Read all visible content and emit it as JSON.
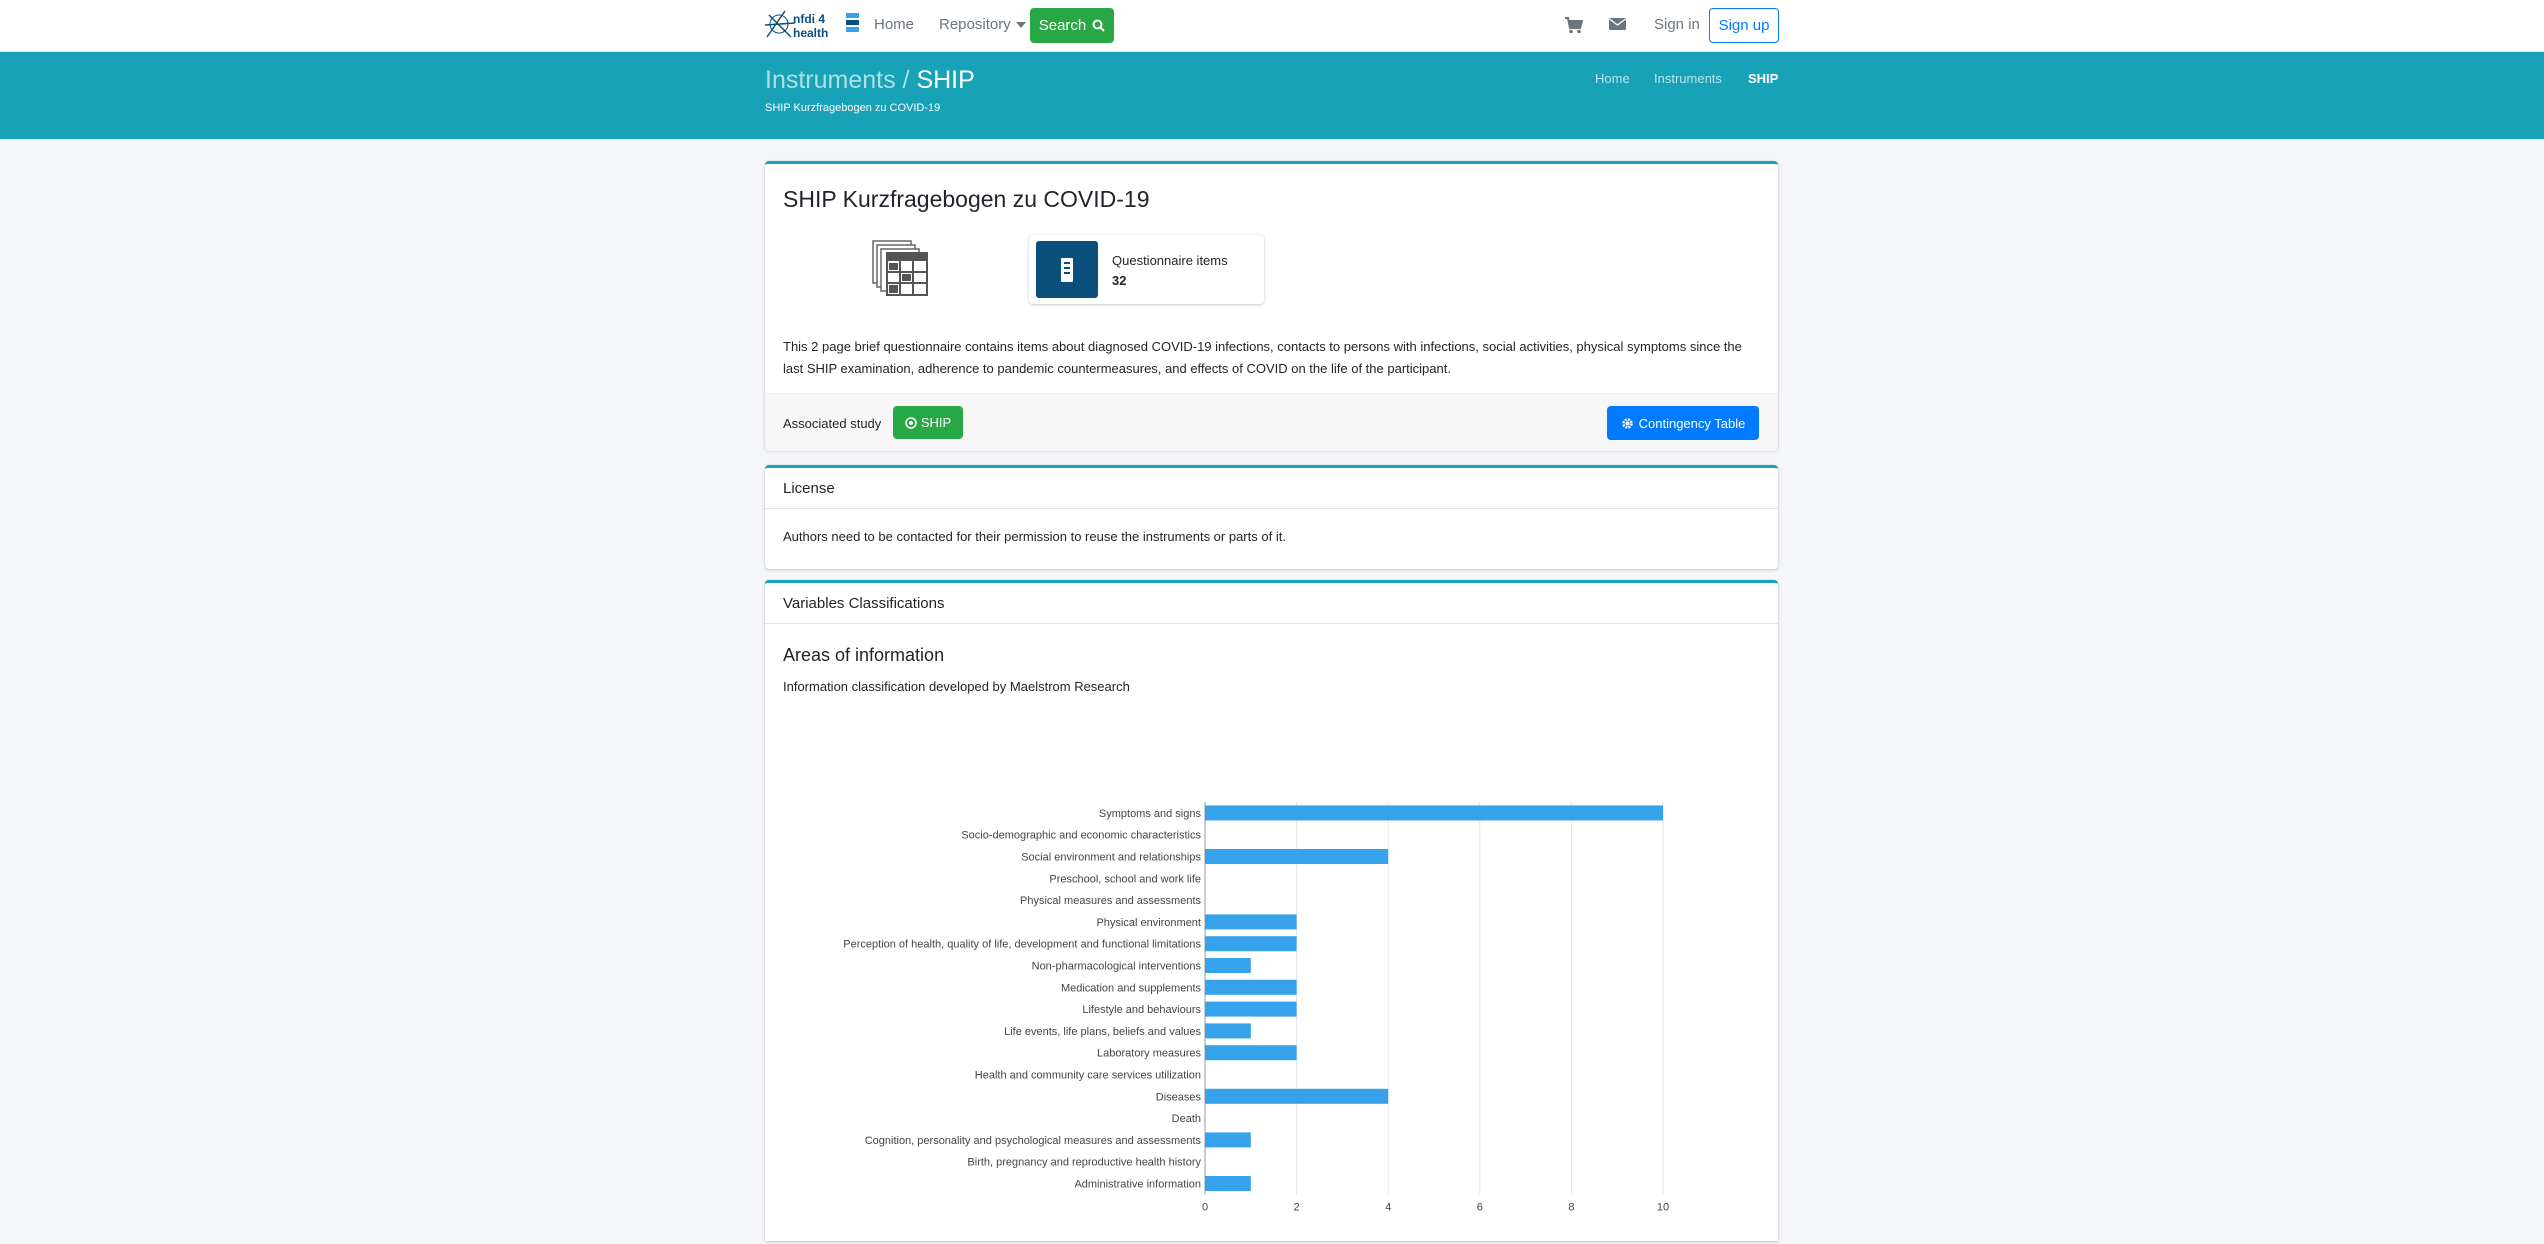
{
  "nav": {
    "logo_text": "nfdi 4 health",
    "home": "Home",
    "repository": "Repository",
    "search": "Search",
    "signin": "Sign in",
    "signup": "Sign up"
  },
  "header": {
    "title_muted": "Instruments /",
    "title_main": "SHIP",
    "subtitle": "SHIP Kurzfragebogen zu COVID-19",
    "breadcrumb": [
      "Home",
      "Instruments",
      "SHIP"
    ]
  },
  "study": {
    "title": "SHIP Kurzfragebogen zu COVID-19",
    "info_label": "Questionnaire items",
    "info_value": "32",
    "description": "This 2 page brief questionnaire contains items about diagnosed COVID-19 infections, contacts to persons with infections, social activities, physical symptoms since the last SHIP examination, adherence to pandemic countermeasures, and effects of COVID on the life of the participant.",
    "assoc_label": "Associated study",
    "assoc_button": "SHIP",
    "contingency_button": "Contingency Table"
  },
  "license": {
    "title": "License",
    "text": "Authors need to be contacted for their permission to reuse the instruments or parts of it."
  },
  "classifications": {
    "title": "Variables Classifications",
    "areas_title": "Areas of information",
    "areas_subtitle": "Information classification developed by Maelstrom Research"
  },
  "colors": {
    "accent": "#17a2b8",
    "bar": "#36a2eb",
    "success": "#28a745",
    "primary": "#007bff"
  },
  "chart_data": {
    "type": "bar",
    "orientation": "horizontal",
    "categories": [
      "Symptoms and signs",
      "Socio-demographic and economic characteristics",
      "Social environment and relationships",
      "Preschool, school and work life",
      "Physical measures and assessments",
      "Physical environment",
      "Perception of health, quality of life, development and functional limitations",
      "Non-pharmacological interventions",
      "Medication and supplements",
      "Lifestyle and behaviours",
      "Life events, life plans, beliefs and values",
      "Laboratory measures",
      "Health and community care services utilization",
      "Diseases",
      "Death",
      "Cognition, personality and psychological measures and assessments",
      "Birth, pregnancy and reproductive health history",
      "Administrative information"
    ],
    "values": [
      10,
      0,
      4,
      0,
      0,
      2,
      2,
      1,
      2,
      2,
      1,
      2,
      0,
      4,
      0,
      1,
      0,
      1
    ],
    "xlim": [
      0,
      10
    ],
    "xticks": [
      "0",
      "2",
      "4",
      "6",
      "8",
      "10"
    ],
    "grid": true
  }
}
